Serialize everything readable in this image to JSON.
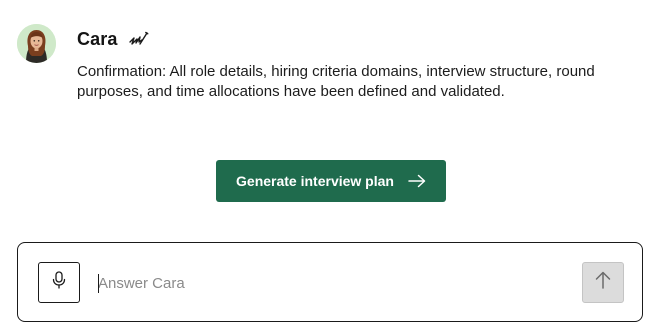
{
  "message": {
    "sender_name": "Cara",
    "sender_icon": "signature-icon",
    "text": "Confirmation: All role details, hiring criteria domains, interview structure, round purposes, and time allocations have been defined and validated."
  },
  "actions": {
    "generate_label": "Generate interview plan",
    "generate_icon": "arrow-right-icon"
  },
  "composer": {
    "placeholder": "Answer Cara",
    "value": "",
    "mic_icon": "microphone-icon",
    "send_icon": "arrow-up-icon",
    "send_enabled": false
  },
  "colors": {
    "primary": "#1f6b4d",
    "send_disabled_bg": "#dcdcdc",
    "avatar_bg": "#cfe9c9"
  }
}
